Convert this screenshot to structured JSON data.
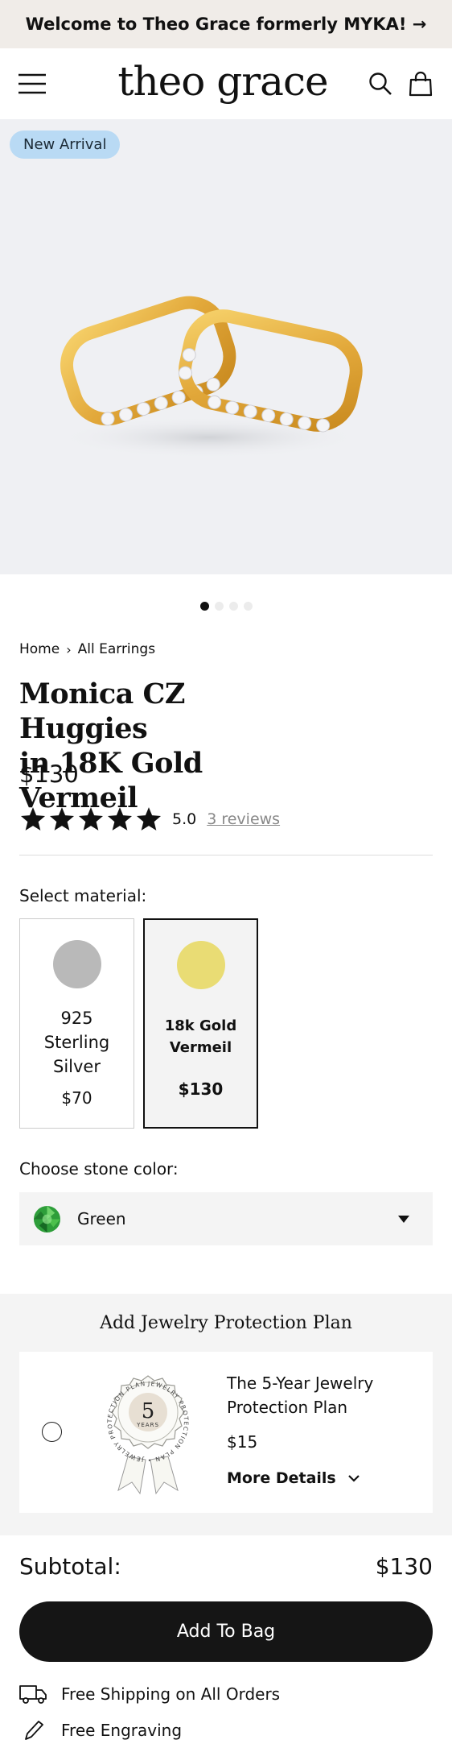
{
  "announcement": {
    "text": "Welcome to Theo Grace formerly MYKA! →"
  },
  "header": {
    "logo": "theo grace",
    "menu_icon": "hamburger-menu-icon",
    "search_icon": "search-icon",
    "bag_icon": "shopping-bag-icon"
  },
  "hero": {
    "badge": "New Arrival",
    "image": "gold-cz-huggie-earrings",
    "slides": 4,
    "active_slide": 1
  },
  "breadcrumb": {
    "home": "Home",
    "separator": "›",
    "current": "All Earrings"
  },
  "product": {
    "title_line1": "Monica CZ Huggies",
    "title_line2": "in 18K Gold Vermeil",
    "price": "$130",
    "rating": 5.0,
    "rating_text": "5.0",
    "reviews": "3 reviews"
  },
  "material": {
    "label": "Select material:",
    "options": [
      {
        "line1": "925",
        "line2": "Sterling",
        "line3": "Silver",
        "price": "$70",
        "color": "#b9b9b9",
        "selected": false
      },
      {
        "line1": "18k Gold",
        "line2": "Vermeil",
        "price": "$130",
        "color": "#e9dc74",
        "selected": true
      }
    ]
  },
  "stone": {
    "label": "Choose stone color:",
    "selected": "Green",
    "color": "#2e9e3a"
  },
  "protection": {
    "title": "Add Jewelry Protection Plan",
    "plan_name": "The 5-Year Jewelry Protection Plan",
    "plan_price": "$15",
    "more": "More Details",
    "seal_number": "5",
    "seal_word": "YEARS",
    "seal_ring": "JEWELRY PROTECTION PLAN • JEWELRY PROTECTION PLAN •"
  },
  "subtotal": {
    "label": "Subtotal:",
    "value": "$130"
  },
  "cta": {
    "add_to_bag": "Add To Bag"
  },
  "perks": [
    {
      "text": "Free Shipping on All Orders",
      "icon": "truck-icon"
    },
    {
      "text": "Free Engraving",
      "icon": "pencil-icon"
    }
  ],
  "colors": {
    "accent": "#151515",
    "announcement_bg": "#f0ece8",
    "badge_bg": "#b9daf4",
    "hero_bg": "#eff0f3"
  }
}
